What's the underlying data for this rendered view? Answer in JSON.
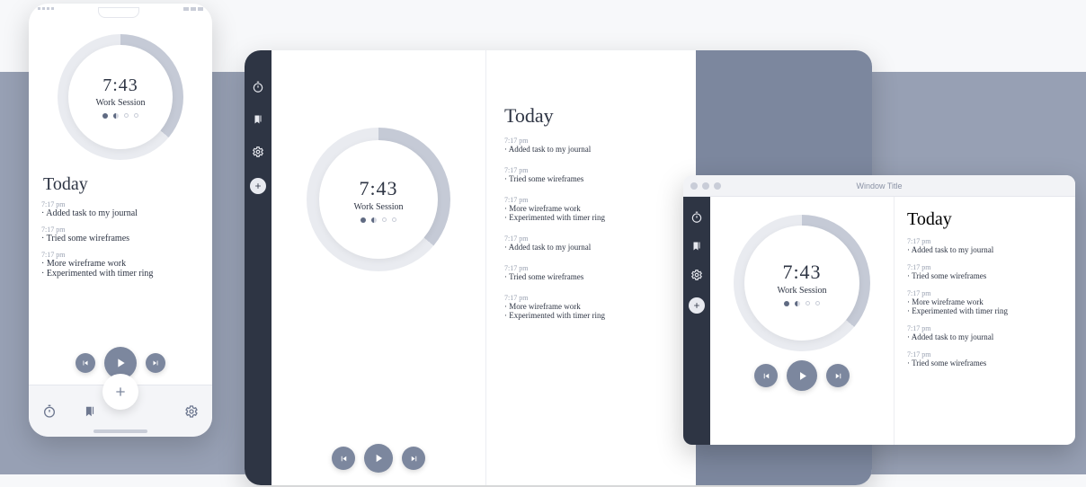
{
  "timer": {
    "time": "7:43",
    "label": "Work Session"
  },
  "today_label": "Today",
  "window_title": "Window Title",
  "entries": [
    {
      "time": "7:17 pm",
      "lines": [
        "Added task to my journal"
      ]
    },
    {
      "time": "7:17 pm",
      "lines": [
        "Tried some wireframes"
      ]
    },
    {
      "time": "7:17 pm",
      "lines": [
        "More wireframe work",
        "Experimented with timer ring"
      ]
    },
    {
      "time": "7:17 pm",
      "lines": [
        "Added task to my journal"
      ]
    },
    {
      "time": "7:17 pm",
      "lines": [
        "Tried some wireframes"
      ]
    },
    {
      "time": "7:17 pm",
      "lines": [
        "More wireframe work",
        "Experimented with timer ring"
      ]
    }
  ],
  "window_entries": [
    {
      "time": "7:17 pm",
      "lines": [
        "Added task to my journal"
      ]
    },
    {
      "time": "7:17 pm",
      "lines": [
        "Tried some wireframes"
      ]
    },
    {
      "time": "7:17 pm",
      "lines": [
        "More wireframe work",
        "Experimented with timer ring"
      ]
    },
    {
      "time": "7:17 pm",
      "lines": [
        "Added task to my journal"
      ]
    },
    {
      "time": "7:17 pm",
      "lines": [
        "Tried some wireframes"
      ]
    }
  ],
  "phone_entries": [
    {
      "time": "7:17 pm",
      "lines": [
        "Added task to my journal"
      ]
    },
    {
      "time": "7:17 pm",
      "lines": [
        "Tried some wireframes"
      ]
    },
    {
      "time": "7:17 pm",
      "lines": [
        "More wireframe work",
        "Experimented with timer ring"
      ]
    }
  ]
}
